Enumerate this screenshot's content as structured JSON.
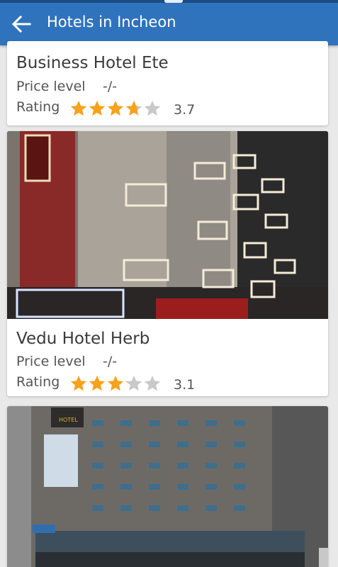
{
  "header": {
    "title": "Hotels in Incheon"
  },
  "hotels": [
    {
      "name": "Business Hotel Ete",
      "price_label": "Price level",
      "price_value": "-/-",
      "rating_label": "Rating",
      "rating_value": "3.7",
      "stars": 3.7
    },
    {
      "name": "Vedu Hotel Herb",
      "price_label": "Price level",
      "price_value": "-/-",
      "rating_label": "Rating",
      "rating_value": "3.1",
      "stars": 3.1
    },
    {
      "name": "",
      "sign_text": "HOTEL"
    }
  ],
  "colors": {
    "appbar": "#2f73bd",
    "star_filled": "#f7a21b",
    "star_empty": "#c9c9c9"
  },
  "icons": {
    "back": "arrow-left-icon",
    "star": "star-icon"
  }
}
